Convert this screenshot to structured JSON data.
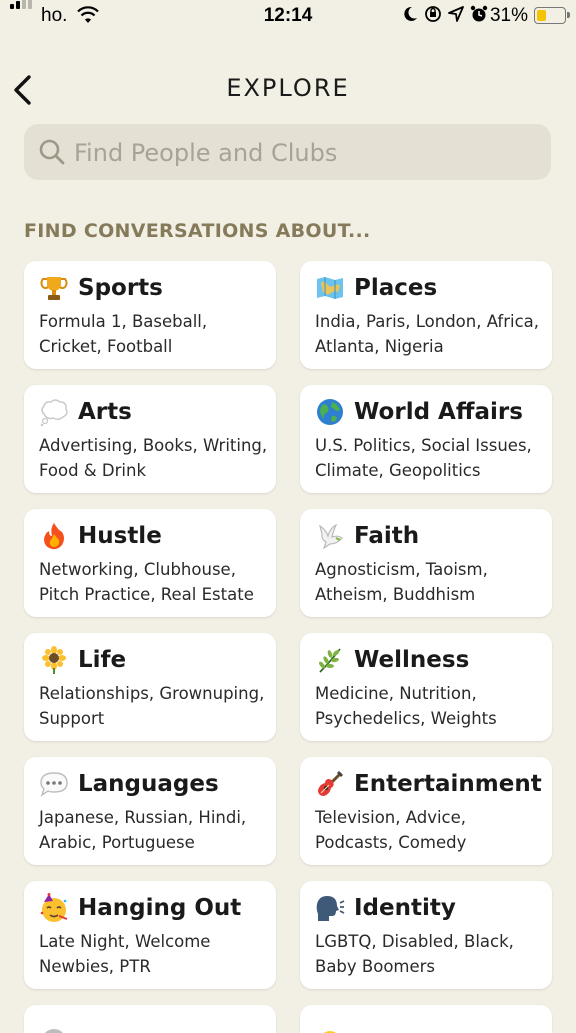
{
  "status_bar": {
    "carrier": "ho.",
    "time": "12:14",
    "battery_percent": "31%",
    "battery_level": 0.31,
    "battery_color": "#f5c400",
    "signal_bars": 2,
    "icons": [
      "wifi-icon",
      "moon-icon",
      "orientation-lock-icon",
      "location-icon",
      "alarm-icon"
    ]
  },
  "header": {
    "back_icon": "chevron-left-icon",
    "title": "EXPLORE"
  },
  "search": {
    "icon": "search-icon",
    "placeholder": "Find People and Clubs",
    "value": ""
  },
  "section_title": "FIND CONVERSATIONS ABOUT...",
  "colors": {
    "background": "#f2efe4",
    "section_title": "#857a5a",
    "card": "#ffffff",
    "search_bg": "#e4e0d4"
  },
  "topics": [
    {
      "emoji": "trophy-icon",
      "title": "Sports",
      "desc": "Formula 1, Baseball, Cricket, Football"
    },
    {
      "emoji": "world-map-icon",
      "title": "Places",
      "desc": "India, Paris, London, Africa, Atlanta, Nigeria"
    },
    {
      "emoji": "thought-balloon-icon",
      "title": "Arts",
      "desc": "Advertising, Books, Writing, Food & Drink"
    },
    {
      "emoji": "globe-icon",
      "title": "World Affairs",
      "desc": "U.S. Politics, Social Issues, Climate, Geopolitics"
    },
    {
      "emoji": "fire-icon",
      "title": "Hustle",
      "desc": "Networking, Clubhouse, Pitch Practice, Real Estate"
    },
    {
      "emoji": "dove-icon",
      "title": "Faith",
      "desc": "Agnosticism, Taoism, Atheism, Buddhism"
    },
    {
      "emoji": "sunflower-icon",
      "title": "Life",
      "desc": "Relationships, Grownuping, Support"
    },
    {
      "emoji": "herb-icon",
      "title": "Wellness",
      "desc": "Medicine, Nutrition, Psychedelics, Weights"
    },
    {
      "emoji": "speech-balloon-icon",
      "title": "Languages",
      "desc": "Japanese, Russian, Hindi, Arabic, Portuguese"
    },
    {
      "emoji": "guitar-icon",
      "title": "Entertainment",
      "desc": "Television, Advice, Podcasts, Comedy"
    },
    {
      "emoji": "party-face-icon",
      "title": "Hanging Out",
      "desc": "Late Night, Welcome Newbies, PTR"
    },
    {
      "emoji": "speaking-head-icon",
      "title": "Identity",
      "desc": "LGBTQ, Disabled, Black, Baby Boomers"
    }
  ]
}
